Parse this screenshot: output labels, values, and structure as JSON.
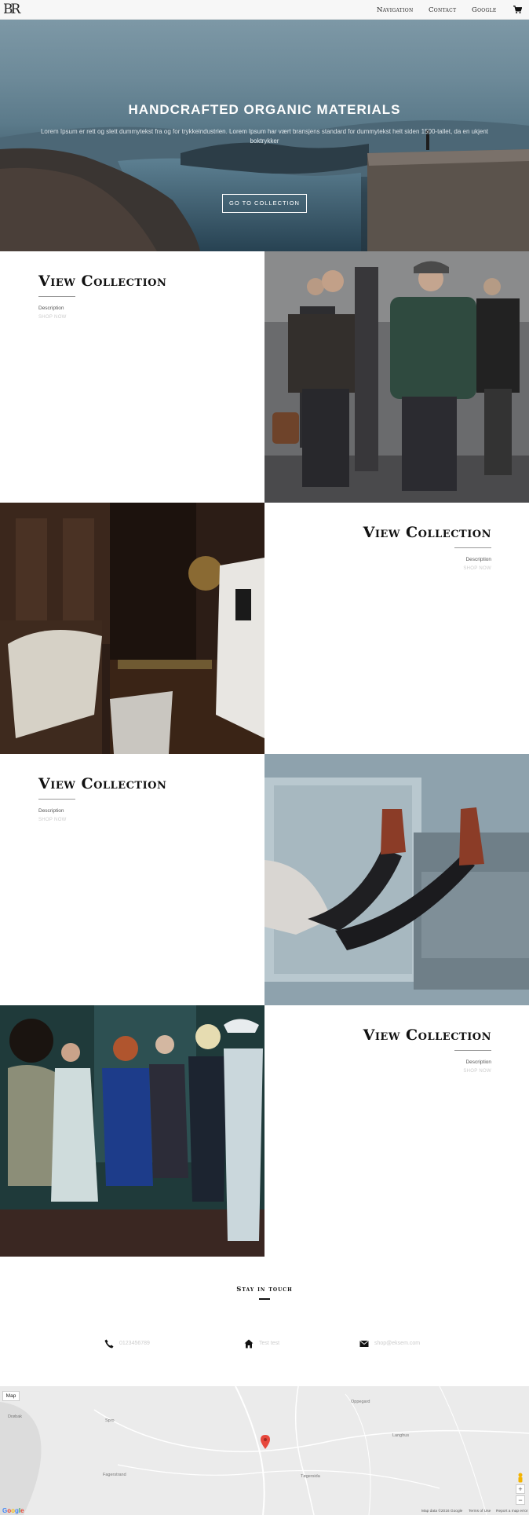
{
  "header": {
    "logo": "BR",
    "nav": [
      "Navigation",
      "Contact",
      "Google"
    ],
    "cart_icon": "cart-icon"
  },
  "hero": {
    "title": "HANDCRAFTED ORGANIC MATERIALS",
    "text": "Lorem Ipsum er rett og slett dummytekst fra og for trykkeindustrien. Lorem Ipsum har vært bransjens standard for dummytekst helt siden 1500-tallet, da en ukjent boktrykker",
    "button": "GO TO COLLECTION"
  },
  "collections": [
    {
      "title": "View Collection",
      "description": "Description",
      "shop": "SHOP NOW"
    },
    {
      "title": "View Collection",
      "description": "Description",
      "shop": "SHOP NOW"
    },
    {
      "title": "View Collection",
      "description": "Description",
      "shop": "SHOP NOW"
    },
    {
      "title": "View Collection",
      "description": "Description",
      "shop": "SHOP NOW"
    }
  ],
  "contact": {
    "heading": "Stay in touch",
    "phone": "0123456789",
    "address": "Test test",
    "email": "shop@eksem.com",
    "icons": [
      "phone-icon",
      "home-icon",
      "mail-icon"
    ]
  },
  "map": {
    "type_button": "Map",
    "places": [
      "Oppegard",
      "Langhus",
      "Tøgersida",
      "Fagerstrand",
      "Spro",
      "Drøbak"
    ],
    "footer": [
      "Map data ©2016 Google",
      "Terms of Use",
      "Report a map error"
    ],
    "zoom_in": "+",
    "zoom_out": "−",
    "google_logo": "Google"
  }
}
